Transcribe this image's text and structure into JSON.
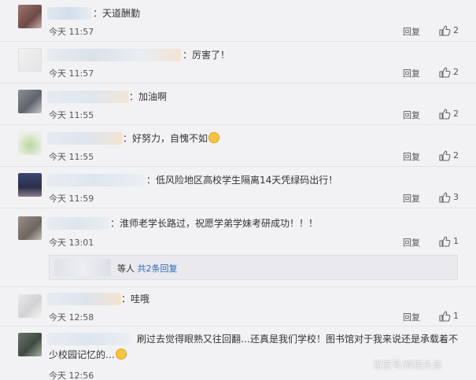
{
  "comments": [
    {
      "text": "：天道酬勤",
      "time": "今天 11:57",
      "reply": "回复",
      "likes": "2",
      "emoji": false
    },
    {
      "text": "：厉害了！",
      "time": "今天 11:57",
      "reply": "回复",
      "likes": "2",
      "emoji": false
    },
    {
      "text": "：加油啊",
      "time": "今天 11:55",
      "reply": "回复",
      "likes": "2",
      "emoji": false
    },
    {
      "text": "：好努力，自愧不如",
      "time": "今天 11:55",
      "reply": "回复",
      "likes": "2",
      "emoji": true
    },
    {
      "text": "：低风险地区高校学生隔离14天凭绿码出行！",
      "time": "今天 11:59",
      "reply": "回复",
      "likes": "3",
      "emoji": false
    },
    {
      "text": "：淮师老学长路过，祝愿学弟学妹考研成功！！！",
      "time": "今天 13:01",
      "reply": "回复",
      "likes": "1",
      "emoji": false
    },
    {
      "text": "：哇哦",
      "time": "今天 12:58",
      "reply": "回复",
      "likes": "1",
      "emoji": false
    },
    {
      "text": "刷过去觉得眼熟又往回翻…还真是我们学校！图书馆对于我来说还是承载着不少校园记忆的…",
      "time": "今天 12:56",
      "reply": "回复",
      "likes": "1",
      "emoji": true
    }
  ],
  "sub_replies": {
    "prefix": "等人 ",
    "link": "共2条回复"
  },
  "watermark": "百家号/辉南头条",
  "icons": {
    "like": "thumbs-up-icon",
    "emoji": "laughing-face-icon"
  },
  "colors": {
    "background": "#f2f2f5",
    "link": "#2a6ab4"
  }
}
